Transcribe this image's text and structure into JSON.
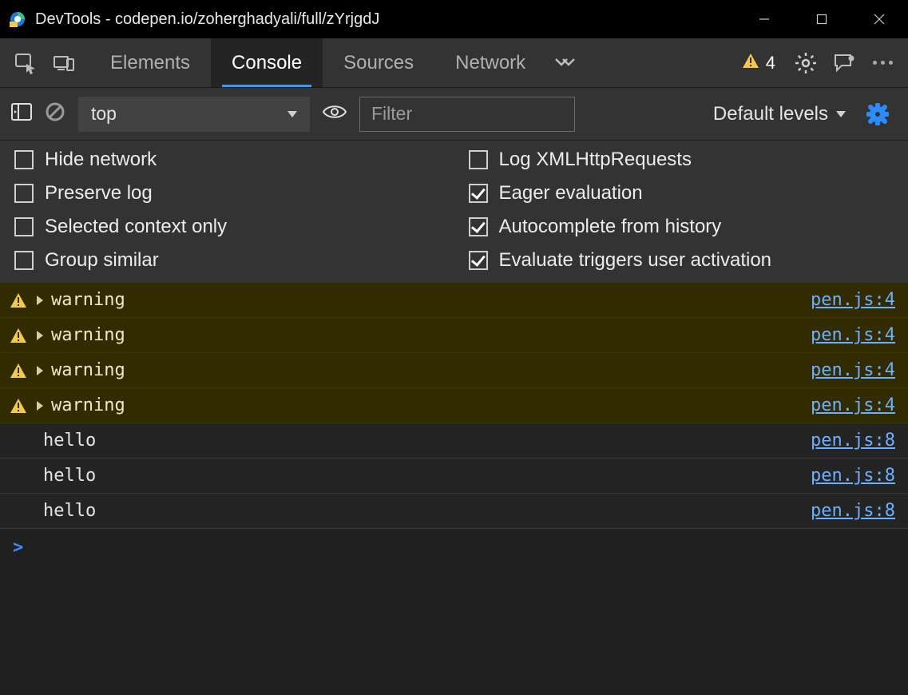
{
  "window": {
    "title": "DevTools - codepen.io/zoherghadyali/full/zYrjgdJ"
  },
  "tabs": {
    "items": [
      {
        "label": "Elements",
        "active": false
      },
      {
        "label": "Console",
        "active": true
      },
      {
        "label": "Sources",
        "active": false
      },
      {
        "label": "Network",
        "active": false
      }
    ],
    "warning_count": "4"
  },
  "console_toolbar": {
    "context": "top",
    "filter_placeholder": "Filter",
    "levels": "Default levels"
  },
  "settings": [
    {
      "label": "Hide network",
      "checked": false
    },
    {
      "label": "Log XMLHttpRequests",
      "checked": false
    },
    {
      "label": "Preserve log",
      "checked": false
    },
    {
      "label": "Eager evaluation",
      "checked": true
    },
    {
      "label": "Selected context only",
      "checked": false
    },
    {
      "label": "Autocomplete from history",
      "checked": true
    },
    {
      "label": "Group similar",
      "checked": false
    },
    {
      "label": "Evaluate triggers user activation",
      "checked": true
    }
  ],
  "logs": [
    {
      "type": "warn",
      "msg": "warning",
      "src": "pen.js:4"
    },
    {
      "type": "warn",
      "msg": "warning",
      "src": "pen.js:4"
    },
    {
      "type": "warn",
      "msg": "warning",
      "src": "pen.js:4"
    },
    {
      "type": "warn",
      "msg": "warning",
      "src": "pen.js:4"
    },
    {
      "type": "info",
      "msg": "hello",
      "src": "pen.js:8"
    },
    {
      "type": "info",
      "msg": "hello",
      "src": "pen.js:8"
    },
    {
      "type": "info",
      "msg": "hello",
      "src": "pen.js:8"
    }
  ],
  "prompt": ">"
}
